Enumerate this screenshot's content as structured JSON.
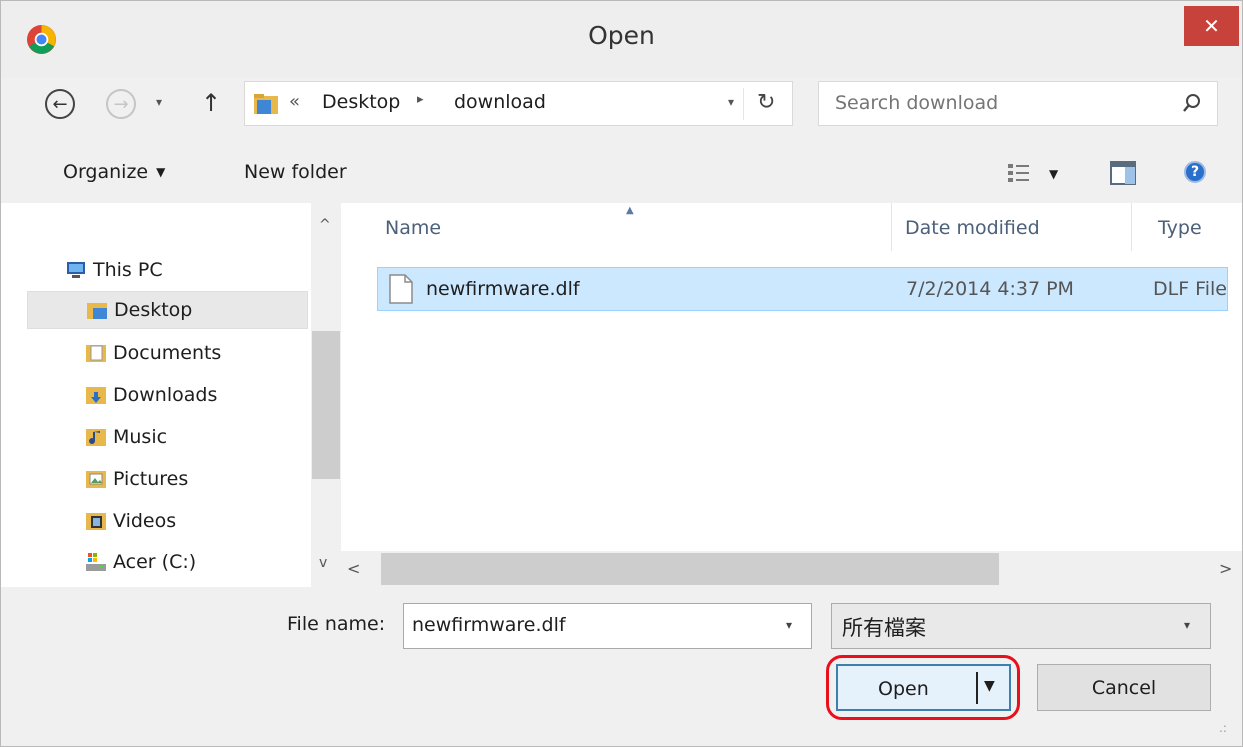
{
  "window": {
    "title": "Open",
    "close_glyph": "✕"
  },
  "nav": {
    "back_glyph": "←",
    "forward_glyph": "→",
    "recent_glyph": "▾",
    "up_glyph": "↑"
  },
  "address": {
    "overflow_glyph": "«",
    "segments": [
      "Desktop",
      "download"
    ],
    "separator_glyph": "▸",
    "dropdown_glyph": "▾",
    "refresh_glyph": "↻"
  },
  "search": {
    "placeholder": "Search download"
  },
  "toolbar": {
    "organize_label": "Organize",
    "organize_caret": "▼",
    "new_folder_label": "New folder",
    "view_caret": "▼",
    "help_glyph": "?"
  },
  "navpane": {
    "items": [
      {
        "label": "This PC",
        "icon": "pc-icon"
      },
      {
        "label": "Desktop",
        "icon": "desktop-folder-icon",
        "selected": true
      },
      {
        "label": "Documents",
        "icon": "documents-folder-icon"
      },
      {
        "label": "Downloads",
        "icon": "downloads-folder-icon"
      },
      {
        "label": "Music",
        "icon": "music-folder-icon"
      },
      {
        "label": "Pictures",
        "icon": "pictures-folder-icon"
      },
      {
        "label": "Videos",
        "icon": "videos-folder-icon"
      },
      {
        "label": "Acer (C:)",
        "icon": "drive-icon"
      }
    ],
    "scroll_up_glyph": "^",
    "scroll_down_glyph": "v"
  },
  "filelist": {
    "columns": [
      "Name",
      "Date modified",
      "Type"
    ],
    "sort_glyph": "▲",
    "rows": [
      {
        "name": "newfirmware.dlf",
        "date": "7/2/2014 4:37 PM",
        "type": "DLF File",
        "selected": true
      }
    ],
    "scroll_left_glyph": "<",
    "scroll_right_glyph": ">"
  },
  "footer": {
    "filename_label": "File name:",
    "filename_value": "newfirmware.dlf",
    "filename_dd_glyph": "▾",
    "filetype_value": "所有檔案",
    "filetype_dd_glyph": "▾",
    "open_label": "Open",
    "open_caret": "▼",
    "cancel_label": "Cancel",
    "grip_glyph": ".:"
  },
  "colors": {
    "close_bg": "#c7423a",
    "selection_bg": "#cce8ff",
    "highlight_ring": "#e8101b"
  }
}
